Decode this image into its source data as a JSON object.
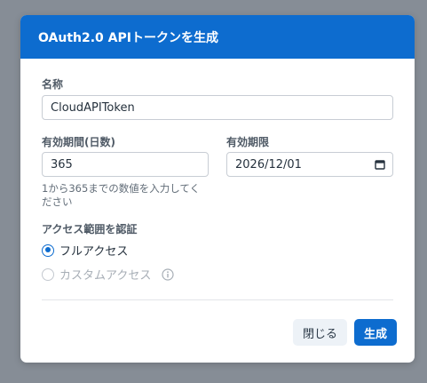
{
  "dialog": {
    "title": "OAuth2.0 APIトークンを生成"
  },
  "form": {
    "name": {
      "label": "名称",
      "value": "CloudAPIToken"
    },
    "validity_days": {
      "label": "有効期間(日数)",
      "value": "365",
      "hint_line1": "1から365までの数値を入力してく",
      "hint_line2": "ださい"
    },
    "expiry": {
      "label": "有効期限",
      "value": "2026/12/01",
      "icon": "calendar-icon"
    },
    "scope": {
      "label": "アクセス範囲を認証",
      "options": [
        {
          "label": "フルアクセス",
          "selected": true,
          "disabled": false
        },
        {
          "label": "カスタムアクセス",
          "selected": false,
          "disabled": true,
          "icon": "info-icon"
        }
      ]
    }
  },
  "buttons": {
    "close_label": "閉じる",
    "generate_label": "生成"
  },
  "colors": {
    "primary": "#0d6ccf",
    "backdrop": "#868d96",
    "secondary_button": "#edf2f7"
  }
}
